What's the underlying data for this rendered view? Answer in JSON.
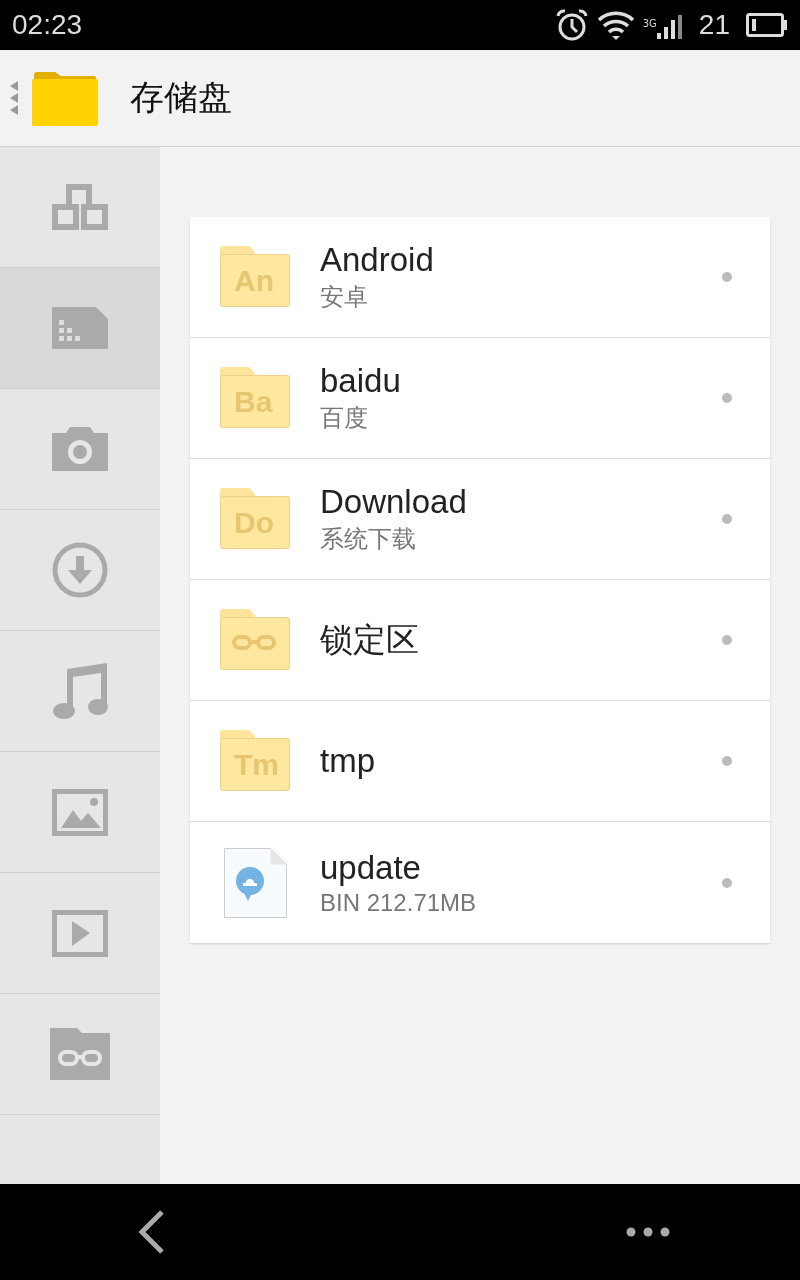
{
  "status_bar": {
    "time": "02:23",
    "network": "3G",
    "battery_text": "21"
  },
  "header": {
    "title": "存储盘"
  },
  "sidebar": {
    "items": [
      {
        "kind": "categories",
        "selected": false
      },
      {
        "kind": "storage",
        "selected": true
      },
      {
        "kind": "camera",
        "selected": false
      },
      {
        "kind": "download",
        "selected": false
      },
      {
        "kind": "music",
        "selected": false
      },
      {
        "kind": "image",
        "selected": false
      },
      {
        "kind": "video",
        "selected": false
      },
      {
        "kind": "locked",
        "selected": false
      }
    ]
  },
  "files": [
    {
      "kind": "folder",
      "badge": "An",
      "name": "Android",
      "detail": "安卓"
    },
    {
      "kind": "folder",
      "badge": "Ba",
      "name": "baidu",
      "detail": "百度"
    },
    {
      "kind": "folder",
      "badge": "Do",
      "name": "Download",
      "detail": "系统下载"
    },
    {
      "kind": "locked",
      "name": "锁定区"
    },
    {
      "kind": "folder",
      "badge": "Tm",
      "name": "tmp"
    },
    {
      "kind": "file",
      "name": "update",
      "detail": "BIN 212.71MB"
    }
  ]
}
